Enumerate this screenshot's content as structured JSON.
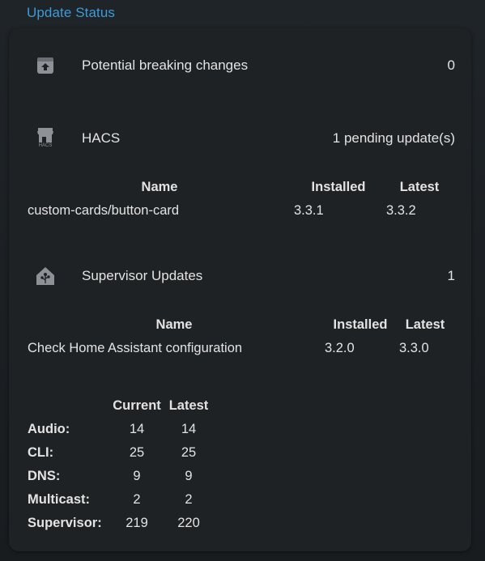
{
  "section_title": "Update Status",
  "rows": {
    "breaking": {
      "label": "Potential breaking changes",
      "value": "0",
      "icon": "package-up-icon"
    },
    "hacs": {
      "label": "HACS",
      "value": "1 pending update(s)",
      "icon": "hacs-store-icon",
      "icon_caption": "HACS"
    },
    "supervisor": {
      "label": "Supervisor Updates",
      "value": "1",
      "icon": "home-assistant-icon"
    }
  },
  "hacs_table": {
    "headers": [
      "Name",
      "Installed",
      "Latest"
    ],
    "rows": [
      [
        "custom-cards/button-card",
        "3.3.1",
        "3.3.2"
      ]
    ]
  },
  "supervisor_table": {
    "headers": [
      "Name",
      "Installed",
      "Latest"
    ],
    "rows": [
      [
        "Check Home Assistant configuration",
        "3.2.0",
        "3.3.0"
      ]
    ]
  },
  "versions_table": {
    "headers": [
      "",
      "Current",
      "Latest"
    ],
    "rows": [
      [
        "Audio:",
        "14",
        "14"
      ],
      [
        "CLI:",
        "25",
        "25"
      ],
      [
        "DNS:",
        "9",
        "9"
      ],
      [
        "Multicast:",
        "2",
        "2"
      ],
      [
        "Supervisor:",
        "219",
        "220"
      ]
    ]
  },
  "colors": {
    "accent": "#3f9ad6",
    "card": "#1f2225",
    "text": "#e3e3e3",
    "icon": "#8e9296"
  }
}
